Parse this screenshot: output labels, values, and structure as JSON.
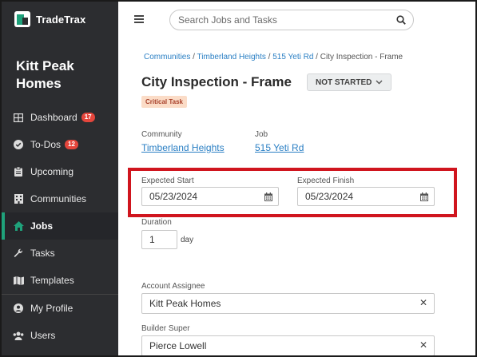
{
  "brand": {
    "name": "TradeTrax"
  },
  "sidebar": {
    "org_name": "Kitt Peak Homes",
    "items": [
      {
        "label": "Dashboard",
        "icon": "dashboard-icon",
        "badge": "17",
        "active": false
      },
      {
        "label": "To-Dos",
        "icon": "check-circle-icon",
        "badge": "12",
        "active": false
      },
      {
        "label": "Upcoming",
        "icon": "clipboard-icon",
        "badge": "",
        "active": false
      },
      {
        "label": "Communities",
        "icon": "building-icon",
        "badge": "",
        "active": false
      },
      {
        "label": "Jobs",
        "icon": "home-icon",
        "badge": "",
        "active": true
      },
      {
        "label": "Tasks",
        "icon": "wrench-icon",
        "badge": "",
        "active": false
      },
      {
        "label": "Templates",
        "icon": "map-icon",
        "badge": "",
        "active": false
      },
      {
        "label": "My Profile",
        "icon": "user-circle-icon",
        "badge": "",
        "active": false
      },
      {
        "label": "Users",
        "icon": "users-icon",
        "badge": "",
        "active": false
      }
    ]
  },
  "search": {
    "placeholder": "Search Jobs and Tasks"
  },
  "breadcrumb": {
    "links": [
      "Communities",
      "Timberland Heights",
      "515 Yeti Rd"
    ],
    "current": "City Inspection - Frame",
    "separator": "/"
  },
  "task": {
    "title": "City Inspection - Frame",
    "status": "NOT STARTED",
    "tag": "Critical Task"
  },
  "fields": {
    "community_label": "Community",
    "community_value": "Timberland Heights",
    "job_label": "Job",
    "job_value": "515 Yeti Rd",
    "expected_start_label": "Expected Start",
    "expected_start_value": "05/23/2024",
    "expected_finish_label": "Expected Finish",
    "expected_finish_value": "05/23/2024",
    "duration_label": "Duration",
    "duration_value": "1",
    "duration_unit": "day",
    "account_assignee_label": "Account Assignee",
    "account_assignee_value": "Kitt Peak Homes",
    "builder_super_label": "Builder Super",
    "builder_super_value": "Pierce Lowell"
  },
  "colors": {
    "sidebar_bg": "#2c2d30",
    "accent": "#1fa27b",
    "link": "#2a7fc4",
    "badge": "#e5463c",
    "highlight": "#d0151e",
    "tag_bg": "#fbdcc7"
  }
}
